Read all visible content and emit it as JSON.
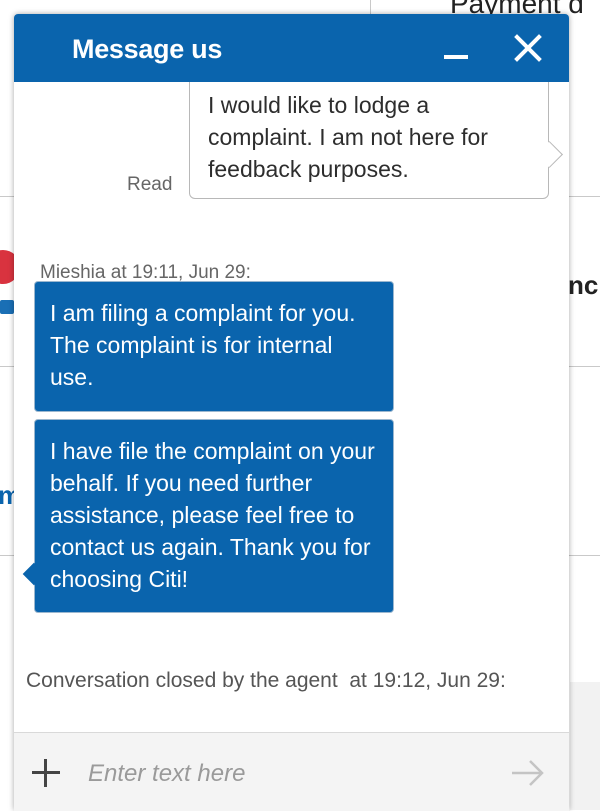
{
  "background": {
    "partial_text_top": "Payment d",
    "partial_text_right": "nc",
    "partial_text_left": "m"
  },
  "chat": {
    "title": "Message us",
    "header_icons": [
      "minimize-icon",
      "close-icon"
    ],
    "brand_color": "#0a64ad",
    "messages": [
      {
        "sender": "user",
        "text": "I would like to lodge a complaint. I am not here for feedback purposes.",
        "status": "Read"
      },
      {
        "sender": "agent",
        "meta": "Mieshia at 19:11, Jun 29:",
        "text": "I am filing a complaint for you. The complaint is for internal use."
      },
      {
        "sender": "agent",
        "text": "I have file the complaint on your behalf. If you need further assistance, please feel free to contact us again. Thank you for choosing Citi!"
      }
    ],
    "closed_note": "Conversation closed by the agent  at 19:12, Jun 29:",
    "composer": {
      "placeholder": "Enter text here",
      "value": "",
      "add_icon": "plus-icon",
      "send_icon": "send-arrow-icon"
    }
  }
}
